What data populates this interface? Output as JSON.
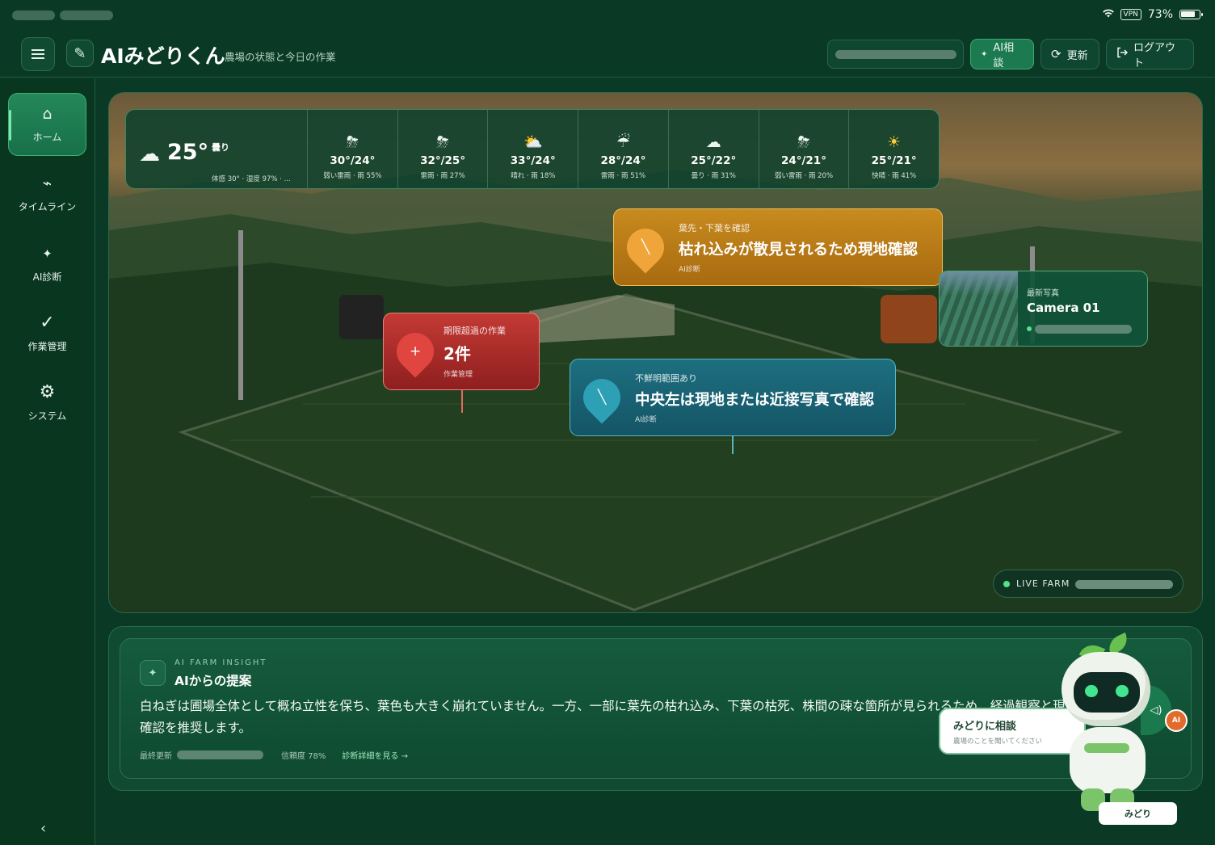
{
  "statusbar": {
    "battery": "73%",
    "vpn": "VPN"
  },
  "header": {
    "title": "AIみどりくん",
    "subtitle": "農場の状態と今日の作業",
    "ai_button": "AI相談",
    "refresh_button": "更新",
    "logout_button": "ログアウト"
  },
  "sidebar": {
    "items": [
      {
        "label": "ホーム",
        "icon": "home-icon"
      },
      {
        "label": "タイムライン",
        "icon": "timeline-icon"
      },
      {
        "label": "AI診断",
        "icon": "sparkle-icon"
      },
      {
        "label": "作業管理",
        "icon": "check-icon"
      },
      {
        "label": "システム",
        "icon": "gear-icon"
      }
    ],
    "collapse": "‹"
  },
  "weather": {
    "current": {
      "temp": "25°",
      "condition": "曇り",
      "detail": "体感 30° · 湿度 97% · ...",
      "icon": "cloud-icon"
    },
    "forecast": [
      {
        "temp": "30°/24°",
        "desc": "弱い雷雨 · 雨 55%",
        "icon": "thunder-sun-icon"
      },
      {
        "temp": "32°/25°",
        "desc": "雷雨 · 雨 27%",
        "icon": "thunder-sun-icon"
      },
      {
        "temp": "33°/24°",
        "desc": "晴れ · 雨 18%",
        "icon": "sun-cloud-icon"
      },
      {
        "temp": "28°/24°",
        "desc": "雷雨 · 雨 51%",
        "icon": "rain-cloud-icon"
      },
      {
        "temp": "25°/22°",
        "desc": "曇り · 雨 31%",
        "icon": "cloud-icon"
      },
      {
        "temp": "24°/21°",
        "desc": "弱い雷雨 · 雨 20%",
        "icon": "thunder-sun-icon"
      },
      {
        "temp": "25°/21°",
        "desc": "快晴 · 雨 41%",
        "icon": "sun-icon"
      }
    ]
  },
  "alerts": {
    "orange": {
      "label": "葉先・下葉を確認",
      "title": "枯れ込みが散見されるため現地確認",
      "tag": "AI診断"
    },
    "red": {
      "label": "期限超過の作業",
      "title": "2件",
      "tag": "作業管理"
    },
    "teal": {
      "label": "不鮮明範囲あり",
      "title": "中央左は現地または近接写真で確認",
      "tag": "AI診断"
    }
  },
  "camera": {
    "label": "最新写真",
    "name": "Camera 01"
  },
  "live": {
    "label": "LIVE FARM"
  },
  "insight": {
    "eyebrow": "AI FARM INSIGHT",
    "title": "AIからの提案",
    "body": "白ねぎは圃場全体として概ね立性を保ち、葉色も大きく崩れていません。一方、一部に葉先の枯れ込み、下葉の枯死、株間の疎な箇所が見られるため、経過観察と現地確認を推奨します。",
    "last_updated": "最終更新",
    "confidence": "信頼度 78%",
    "details_link": "診断詳細を見る →"
  },
  "mascot": {
    "chat_title": "みどりに相談",
    "chat_sub": "農場のことを聞いてください",
    "badge": "AI",
    "name": "みどり"
  },
  "colors": {
    "background": "#0a3a26",
    "accent": "#1b7a4f",
    "alert_orange": "#c78b1e",
    "alert_red": "#c43a34",
    "alert_teal": "#1d6f80",
    "live": "#55e08a"
  }
}
